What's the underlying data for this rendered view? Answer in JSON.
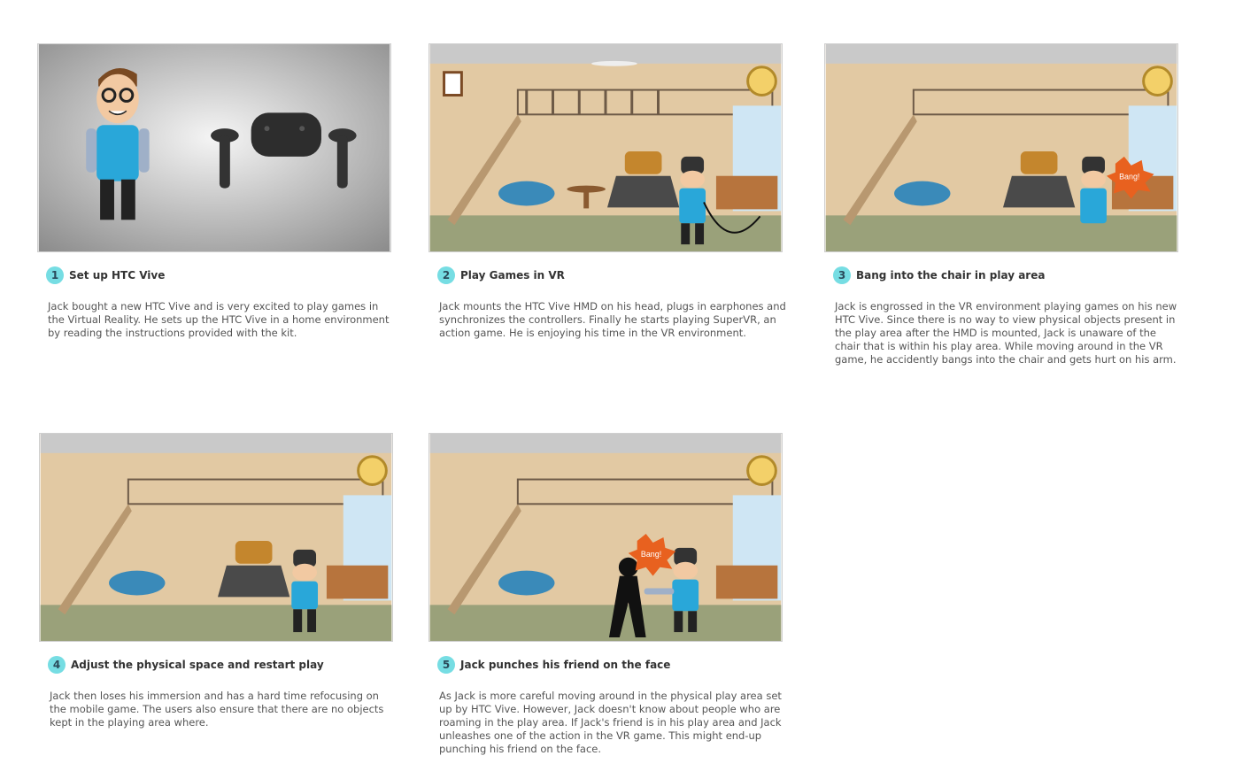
{
  "panels": [
    {
      "num": "1",
      "title": "Set up HTC Vive",
      "text": "Jack bought a new HTC Vive and is very excited to play games in the Virtual Reality. He sets up the HTC Vive in a home environment by reading the instructions provided with the kit."
    },
    {
      "num": "2",
      "title": "Play Games in VR",
      "text": "Jack mounts the HTC Vive HMD on his head, plugs in earphones and synchronizes the controllers. Finally he starts playing SuperVR, an action game. He is enjoying his time in the VR environment."
    },
    {
      "num": "3",
      "title": "Bang into the chair in play area",
      "text": "Jack is engrossed in the VR environment playing games on his new HTC Vive. Since there is no way to view physical objects present in the play area after the HMD is mounted, Jack is unaware of the chair that is within his play area. While moving around in the VR game, he accidently bangs into the chair and gets hurt on his arm."
    },
    {
      "num": "4",
      "title": "Adjust the physical space and restart play",
      "text": "Jack then loses his immersion and has a hard time refocusing on the mobile game. The users also ensure that there are no objects kept in the playing area where."
    },
    {
      "num": "5",
      "title": "Jack punches his friend on the face",
      "text": "As Jack is more careful moving around in the physical play area set up by HTC Vive. However, Jack doesn't know about people who are roaming in the play area. If Jack's friend is in his play area and Jack unleashes one of the action in the VR game. This might end-up punching his friend on the face."
    }
  ],
  "bang_label": "Bang!"
}
